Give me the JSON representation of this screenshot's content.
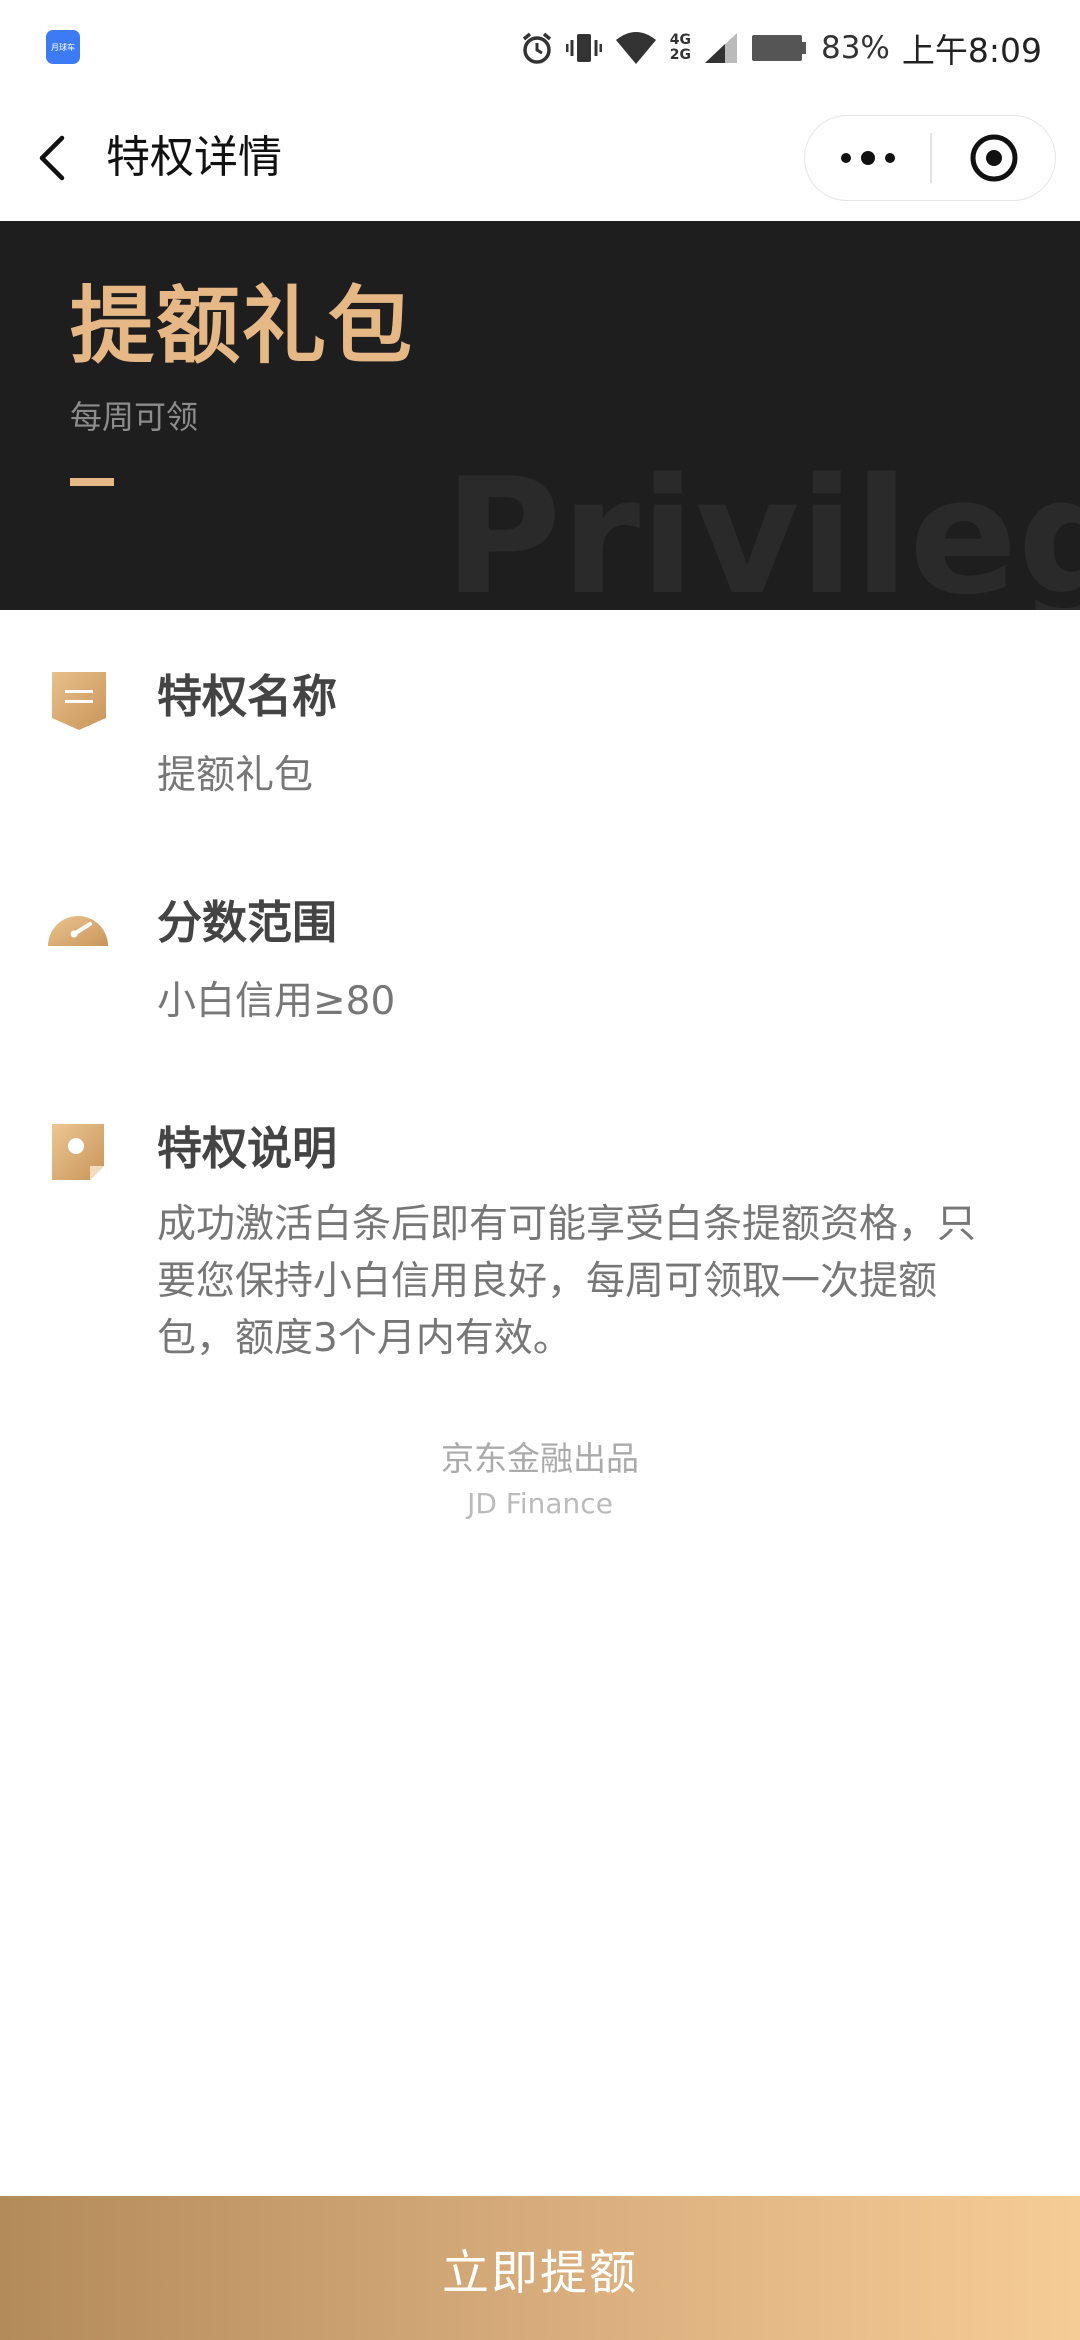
{
  "status_bar": {
    "app_badge": "月球车",
    "net_top": "4G",
    "net_bottom": "2G",
    "battery_percent": "83%",
    "time": "上午8:09"
  },
  "nav": {
    "title": "特权详情"
  },
  "hero": {
    "title": "提额礼包",
    "subtitle": "每周可领",
    "watermark": "Privilege"
  },
  "sections": [
    {
      "icon": "document-icon",
      "title": "特权名称",
      "body": "提额礼包"
    },
    {
      "icon": "gauge-icon",
      "title": "分数范围",
      "body": "小白信用≥80"
    },
    {
      "icon": "note-icon",
      "title": "特权说明",
      "body": "成功激活白条后即有可能享受白条提额资格，只要您保持小白信用良好，每周可领取一次提额包，额度3个月内有效。"
    }
  ],
  "footer": {
    "line1": "京东金融出品",
    "line2": "JD Finance"
  },
  "cta": {
    "label": "立即提额"
  },
  "colors": {
    "gold": "#e5b886",
    "hero_bg": "#1e1e1e",
    "cta_start": "#b38a5a",
    "cta_end": "#f6cc96"
  }
}
